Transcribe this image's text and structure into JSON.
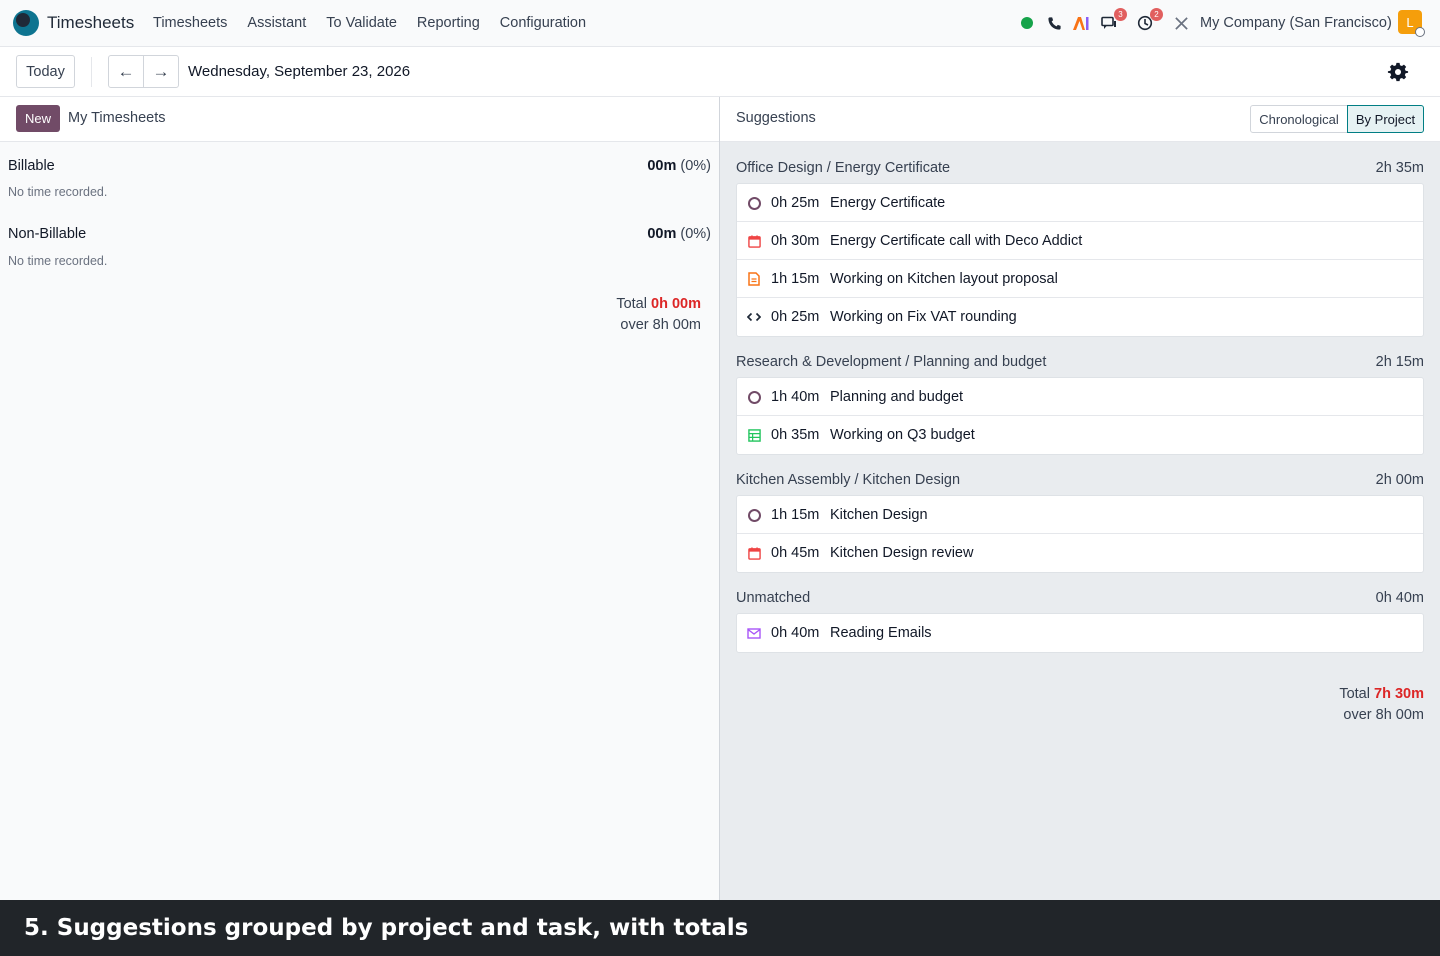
{
  "navbar": {
    "app_title": "Timesheets",
    "menu": [
      "Timesheets",
      "Assistant",
      "To Validate",
      "Reporting",
      "Configuration"
    ],
    "messages_badge": "3",
    "activities_badge": "2",
    "company": "My Company (San Francisco)",
    "avatar_initial": "L"
  },
  "control": {
    "today_label": "Today",
    "prev_icon": "←",
    "next_icon": "→",
    "date": "Wednesday, September 23, 2026"
  },
  "left": {
    "new_label": "New",
    "title": "My Timesheets",
    "billable": {
      "label": "Billable",
      "value": "00m",
      "pct": "(0%)",
      "empty": "No time recorded."
    },
    "non_billable": {
      "label": "Non-Billable",
      "value": "00m",
      "pct": "(0%)",
      "empty": "No time recorded."
    },
    "total_label": "Total",
    "total_value": "0h 00m",
    "over_label": "over 8h 00m"
  },
  "right": {
    "title": "Suggestions",
    "toggle_chrono": "Chronological",
    "toggle_project": "By Project",
    "groups": [
      {
        "title": "Office Design / Energy Certificate",
        "total": "2h 35m",
        "items": [
          {
            "icon": "task-icon",
            "duration": "0h 25m",
            "name": "Energy Certificate"
          },
          {
            "icon": "calendar-icon",
            "duration": "0h 30m",
            "name": "Energy Certificate call with Deco Addict"
          },
          {
            "icon": "document-icon",
            "duration": "1h 15m",
            "name": "Working on Kitchen layout proposal"
          },
          {
            "icon": "code-icon",
            "duration": "0h 25m",
            "name": "Working on Fix VAT rounding"
          }
        ]
      },
      {
        "title": "Research & Development / Planning and budget",
        "total": "2h 15m",
        "items": [
          {
            "icon": "task-icon",
            "duration": "1h 40m",
            "name": "Planning and budget"
          },
          {
            "icon": "spreadsheet-icon",
            "duration": "0h 35m",
            "name": "Working on Q3 budget"
          }
        ]
      },
      {
        "title": "Kitchen Assembly / Kitchen Design",
        "total": "2h 00m",
        "items": [
          {
            "icon": "task-icon",
            "duration": "1h 15m",
            "name": "Kitchen Design"
          },
          {
            "icon": "calendar-icon",
            "duration": "0h 45m",
            "name": "Kitchen Design review"
          }
        ]
      },
      {
        "title": "Unmatched",
        "total": "0h 40m",
        "items": [
          {
            "icon": "email-icon",
            "duration": "0h 40m",
            "name": "Reading Emails"
          }
        ]
      }
    ],
    "total_label": "Total",
    "total_value": "7h 30m",
    "over_label": "over 8h 00m"
  },
  "caption": "5. Suggestions grouped by project and task, with totals",
  "colors": {
    "brand": "#714b67",
    "accent": "#017e84",
    "danger": "#dc2626"
  }
}
